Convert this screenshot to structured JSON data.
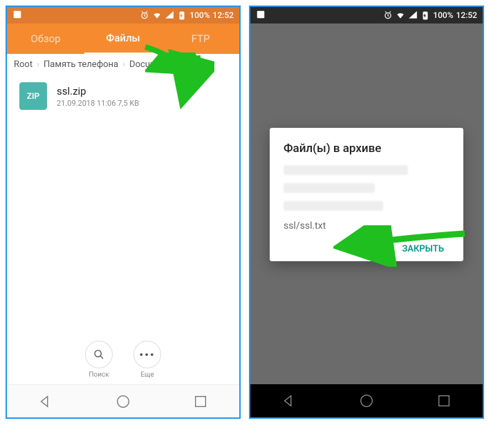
{
  "statusbar": {
    "battery": "100%",
    "time": "12:52"
  },
  "tabs": {
    "overview": "Обзор",
    "files": "Файлы",
    "ftp": "FTP"
  },
  "breadcrumb": {
    "root": "Root",
    "phone_memory": "Память телефона",
    "document": "Document"
  },
  "file": {
    "badge": "ZIP",
    "name": "ssl.zip",
    "meta": "21.09.2018 11:06  7,5 KB"
  },
  "actions": {
    "search": "Поиск",
    "more": "Еще"
  },
  "dialog": {
    "title": "Файл(ы) в архиве",
    "item": "ssl/ssl.txt",
    "close": "ЗАКРЫТЬ"
  }
}
